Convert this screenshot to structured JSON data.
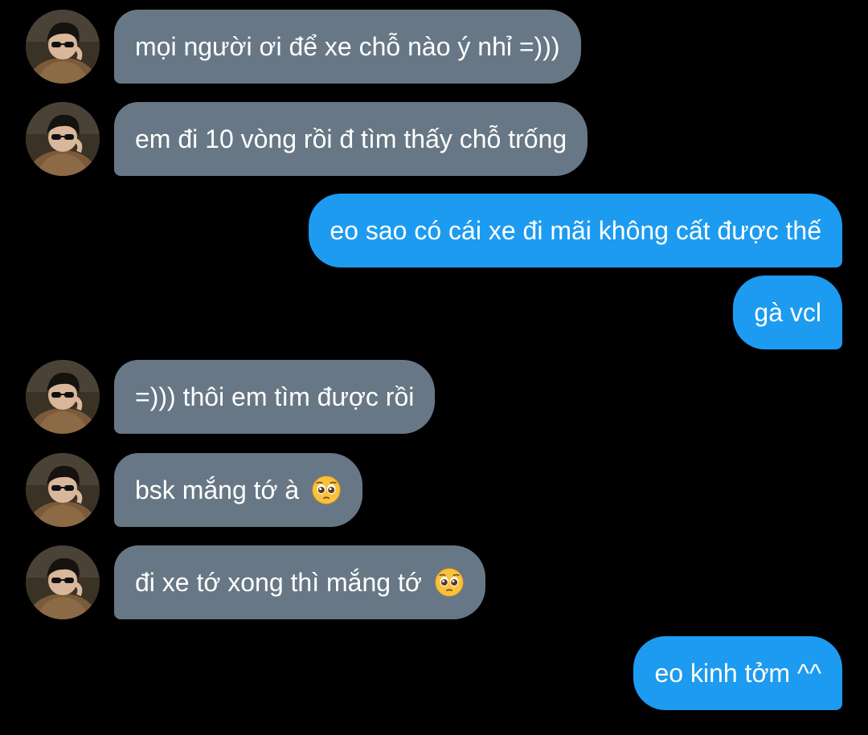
{
  "colors": {
    "background": "#000000",
    "incoming_bubble": "#687785",
    "outgoing_bubble": "#1d9bf0",
    "text": "#ffffff"
  },
  "messages": [
    {
      "direction": "in",
      "text": "mọi người ơi để xe chỗ nào ý nhỉ =)))",
      "avatar": "sender-avatar"
    },
    {
      "direction": "in",
      "text": "em đi 10 vòng rồi đ tìm thấy chỗ trống",
      "avatar": "sender-avatar"
    },
    {
      "direction": "out",
      "text": "eo sao có cái xe đi mãi không cất được thế"
    },
    {
      "direction": "out",
      "text": "gà vcl"
    },
    {
      "direction": "in",
      "text": "=))) thôi em tìm được rồi",
      "avatar": "sender-avatar"
    },
    {
      "direction": "in",
      "text": "bsk mắng tớ à",
      "emoji": "pleading-face-icon",
      "avatar": "sender-avatar"
    },
    {
      "direction": "in",
      "text": "đi xe tớ xong thì mắng tớ",
      "emoji": "pleading-face-icon",
      "avatar": "sender-avatar"
    },
    {
      "direction": "out",
      "text": "eo kinh tởm ^^"
    }
  ]
}
